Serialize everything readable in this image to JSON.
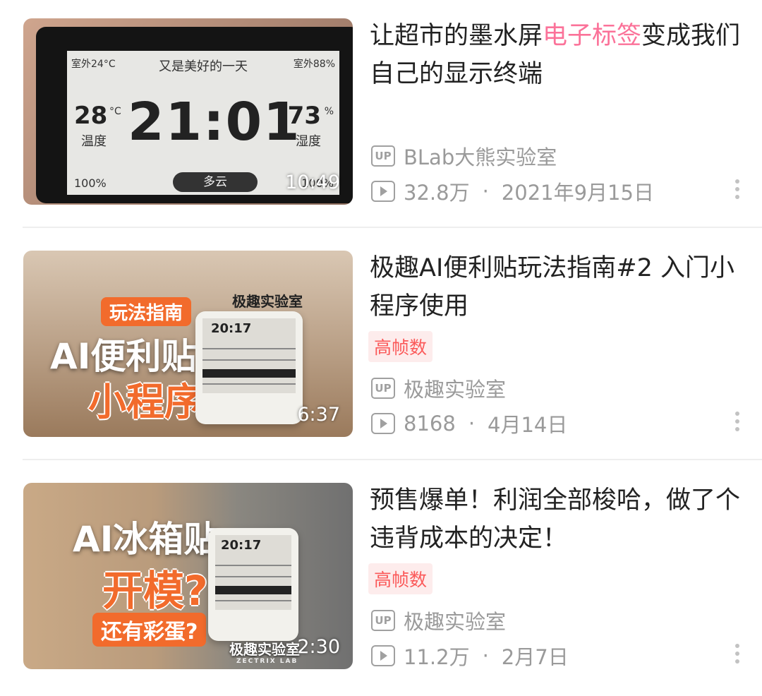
{
  "videos": [
    {
      "duration": "10:49",
      "title_parts": {
        "before": "让超市的墨水屏",
        "highlight": "电子标签",
        "after": "变成我们自己的显示终端"
      },
      "tag": "",
      "uploader": "BLab大熊实验室",
      "views": "32.8万",
      "date": "2021年9月15日",
      "thumb_text": {
        "top_left": "室外24°C",
        "top_center": "又是美好的一天",
        "top_right": "室外88%",
        "clock": "21:01",
        "left_value": "28",
        "left_unit": "°C",
        "left_label": "温度",
        "right_value": "73",
        "right_unit": "%",
        "right_label": "湿度",
        "battery": "100%",
        "weather": "多云",
        "signal": "100%"
      }
    },
    {
      "duration": "6:37",
      "title": "极趣AI便利贴玩法指南#2 入门小程序使用",
      "tag": "高帧数",
      "uploader": "极趣实验室",
      "views": "8168",
      "date": "4月14日",
      "thumb_text": {
        "badge": "玩法指南",
        "brand": "极趣实验室",
        "line1": "AI便利贴",
        "line2": "小程序",
        "device_time": "20:17"
      }
    },
    {
      "duration": "2:30",
      "title": "预售爆单！利润全部梭哈，做了个违背成本的决定！",
      "tag": "高帧数",
      "uploader": "极趣实验室",
      "views": "11.2万",
      "date": "2月7日",
      "thumb_text": {
        "line1": "AI冰箱贴",
        "line2": "开模?",
        "badge": "还有彩蛋?",
        "brand": "极趣实验室",
        "brand_sub": "ZECTRIX LAB",
        "device_time": "20:17"
      }
    }
  ],
  "icons": {
    "uploader": "up-icon",
    "views": "play-icon",
    "more": "more-icon"
  },
  "up_label": "UP",
  "colors": {
    "highlight": "#fb7299",
    "tag_text": "#fb5a5a",
    "tag_bg": "#fdecec",
    "meta": "#9a9a9a"
  }
}
